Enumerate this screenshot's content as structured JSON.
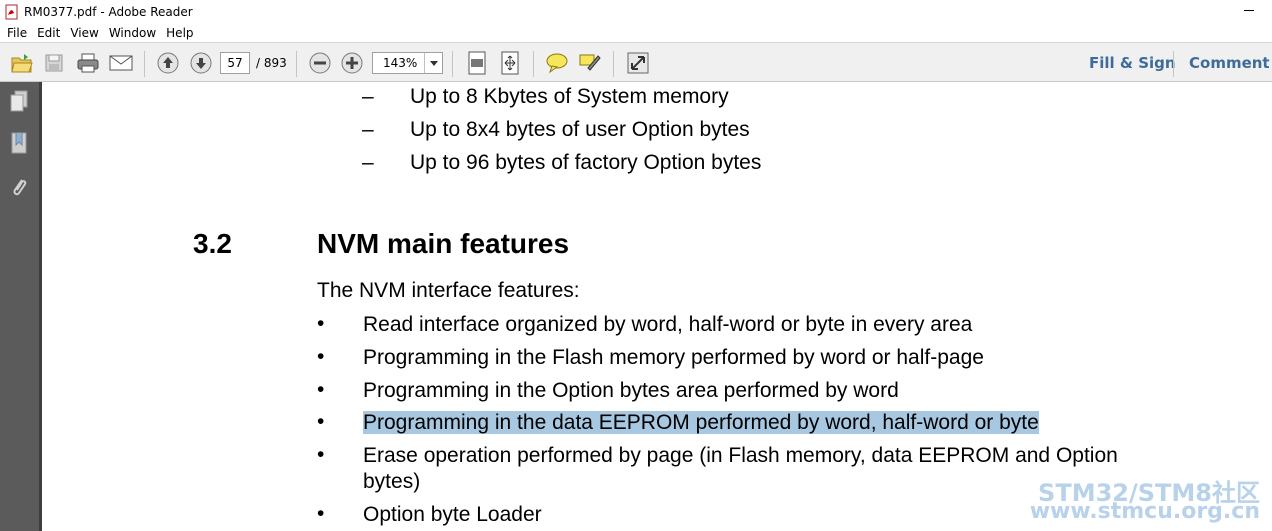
{
  "window": {
    "title": "RM0377.pdf - Adobe Reader"
  },
  "menu": [
    "File",
    "Edit",
    "View",
    "Window",
    "Help"
  ],
  "toolbar": {
    "page_current": "57",
    "page_total": "/ 893",
    "zoom": "143%",
    "fill_sign_label": "Fill & Sign",
    "comment_label": "Comment"
  },
  "icons": {
    "open": "folder-open-icon",
    "save": "save-icon",
    "print": "print-icon",
    "email": "email-icon",
    "prev_page": "arrow-up-icon",
    "next_page": "arrow-down-icon",
    "zoom_out": "minus-icon",
    "zoom_in": "plus-icon",
    "fit_page": "fit-page-icon",
    "fit_width": "fit-width-icon",
    "comment": "speech-bubble-icon",
    "highlight": "highlighter-icon",
    "fullscreen": "expand-icon"
  },
  "colors": {
    "accent_link": "#3f6b9a",
    "highlight": "#a8c7e0",
    "left_pane": "#5b5b5b",
    "toolbar_bg": "#f0f0f0"
  },
  "document": {
    "dash_items": [
      "Up to 8 Kbytes of System memory",
      "Up to 8x4 bytes of user Option bytes",
      "Up to 96 bytes of factory Option bytes"
    ],
    "dash_symbol": "–",
    "section_number": "3.2",
    "section_title": "NVM main features",
    "intro": "The NVM interface features:",
    "bullet_symbol": "•",
    "bullets": [
      "Read interface organized by word, half-word or byte in every area",
      "Programming in the Flash memory performed by word or half-page",
      "Programming in the Option bytes area performed by word",
      "Programming in the data EEPROM performed by word, half-word or byte",
      "Erase operation performed by page (in Flash memory, data EEPROM and Option bytes)",
      "Option byte Loader"
    ],
    "highlighted_bullet_index": 3
  },
  "watermark": {
    "line1": "STM32/STM8社区",
    "line2": "www.stmcu.org.cn"
  }
}
